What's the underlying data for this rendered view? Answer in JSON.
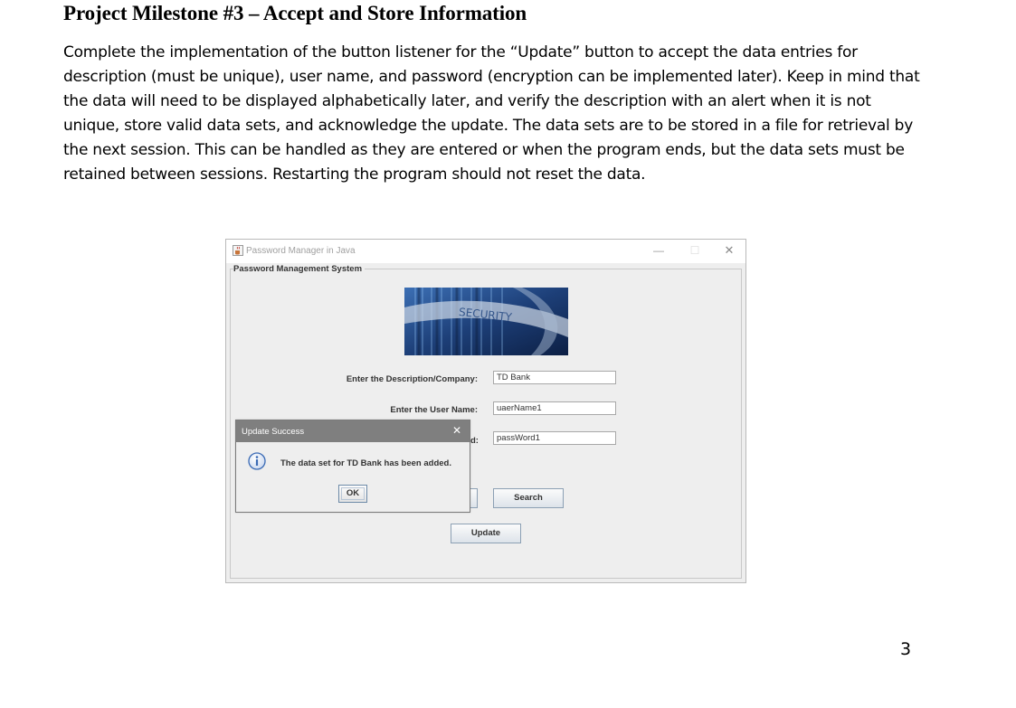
{
  "document": {
    "title": "Project Milestone #3 – Accept and Store Information",
    "paragraph": "Complete the implementation of the button listener for the “Update” button to accept the data entries for description (must be unique), user name, and password (encryption can be implemented later). Keep in mind that the data will need to be displayed alphabetically later, and verify the description with an alert when it is not unique, store valid data sets, and acknowledge the update. The data sets are to be stored in a file for retrieval by the next session.  This can be handled as they are entered or when the program ends, but the data sets must be retained between sessions. Restarting the program should not reset the data.",
    "page_number": "3"
  },
  "window": {
    "title": "Password Manager in Java",
    "panel_title": "Password Management System",
    "banner_text": "SECURITY",
    "icons": {
      "app": "java-cup-icon",
      "minimize": "minimize-icon",
      "maximize": "maximize-icon",
      "close": "close-icon"
    },
    "form": {
      "description_label": "Enter the Description/Company:",
      "description_value": "TD Bank",
      "username_label": "Enter the User Name:",
      "username_value": "uaerName1",
      "password_label_visible": "d:",
      "password_value": "passWord1"
    },
    "buttons": {
      "search": "Search",
      "update": "Update"
    }
  },
  "dialog": {
    "title": "Update Success",
    "message": "The data set for TD Bank has been added.",
    "ok": "OK",
    "icon": "info-icon"
  },
  "colors": {
    "dialog_titlebar": "#7f7f7f",
    "window_bg": "#eeeeee",
    "info_icon": "#3b6bb5"
  }
}
